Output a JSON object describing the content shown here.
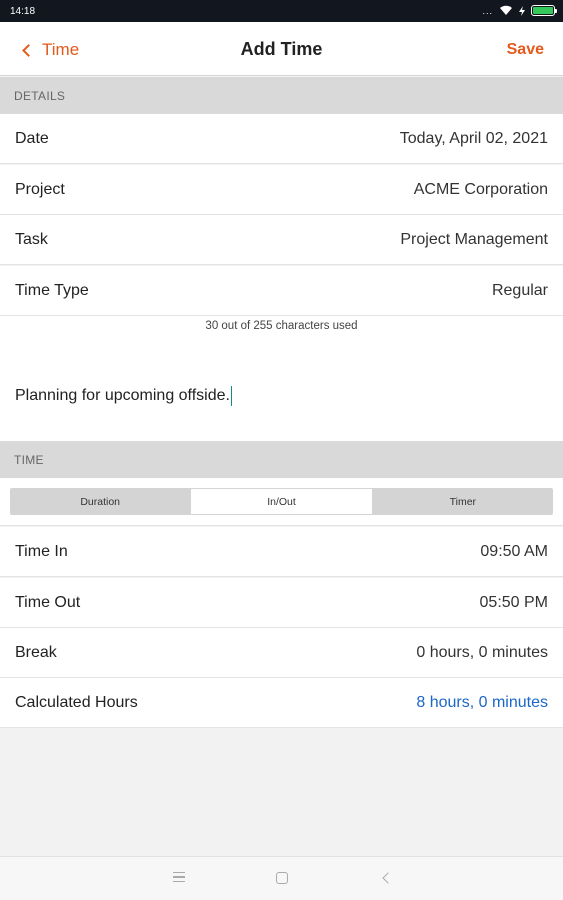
{
  "status_bar": {
    "time": "14:18",
    "dots": "..."
  },
  "nav": {
    "back_label": "Time",
    "title": "Add Time",
    "save_label": "Save"
  },
  "details": {
    "header": "DETAILS",
    "rows": [
      {
        "label": "Date",
        "value": "Today, April 02, 2021"
      },
      {
        "label": "Project",
        "value": "ACME Corporation"
      },
      {
        "label": "Task",
        "value": "Project Management"
      },
      {
        "label": "Time Type",
        "value": "Regular"
      }
    ],
    "char_count": "30 out of 255 characters used",
    "notes": "Planning for upcoming offside."
  },
  "time": {
    "header": "TIME",
    "segments": [
      "Duration",
      "In/Out",
      "Timer"
    ],
    "active_segment": "In/Out",
    "rows": [
      {
        "label": "Time In",
        "value": "09:50 AM"
      },
      {
        "label": "Time Out",
        "value": "05:50 PM"
      },
      {
        "label": "Break",
        "value": "0 hours, 0 minutes"
      },
      {
        "label": "Calculated Hours",
        "value": "8 hours, 0 minutes"
      }
    ]
  },
  "colors": {
    "accent": "#e35a1c",
    "link": "#1a66c9",
    "status_bar": "#11161f"
  },
  "icons": [
    "wifi-icon",
    "bolt-icon",
    "battery-icon",
    "chevron-left-icon",
    "menu-icon",
    "home-icon",
    "back-icon"
  ]
}
